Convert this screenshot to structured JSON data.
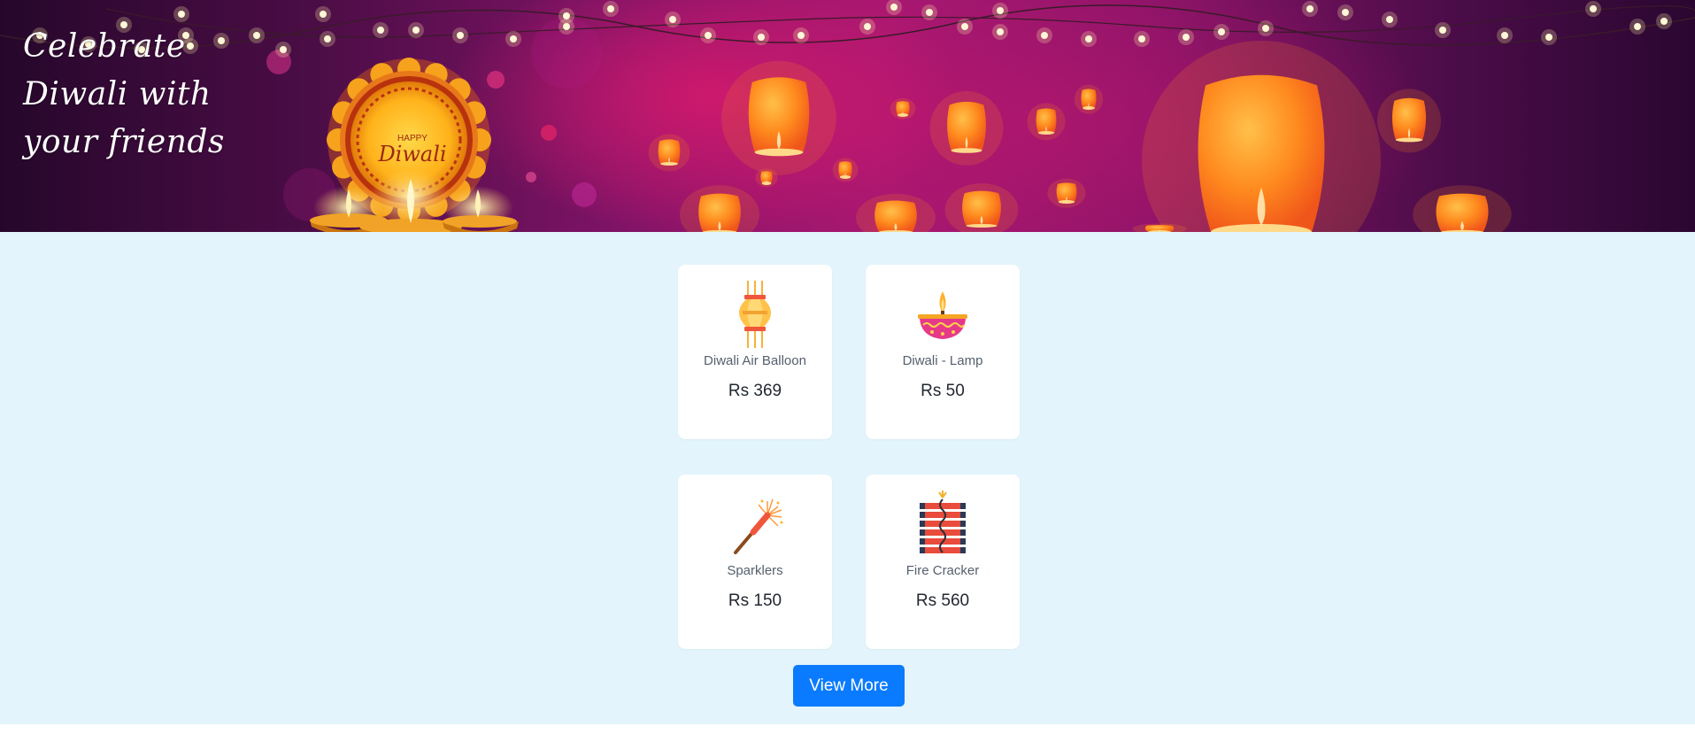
{
  "banner": {
    "title_lines": [
      "Celebrate",
      "Diwali with",
      "your friends"
    ],
    "rangoli_text_top": "HAPPY",
    "rangoli_text_main": "Diwali"
  },
  "products": [
    {
      "name": "Diwali Air Balloon",
      "price": "Rs 369",
      "icon": "lantern-icon"
    },
    {
      "name": "Diwali - Lamp",
      "price": "Rs 50",
      "icon": "diya-lamp-icon"
    },
    {
      "name": "Sparklers",
      "price": "Rs 150",
      "icon": "sparkler-icon"
    },
    {
      "name": "Fire Cracker",
      "price": "Rs 560",
      "icon": "firecracker-icon"
    }
  ],
  "view_more_label": "View More",
  "colors": {
    "content_bg": "#e3f4fc",
    "button": "#0a7bff",
    "banner_magenta": "#a51872",
    "lantern_orange": "#ff8a1e"
  }
}
